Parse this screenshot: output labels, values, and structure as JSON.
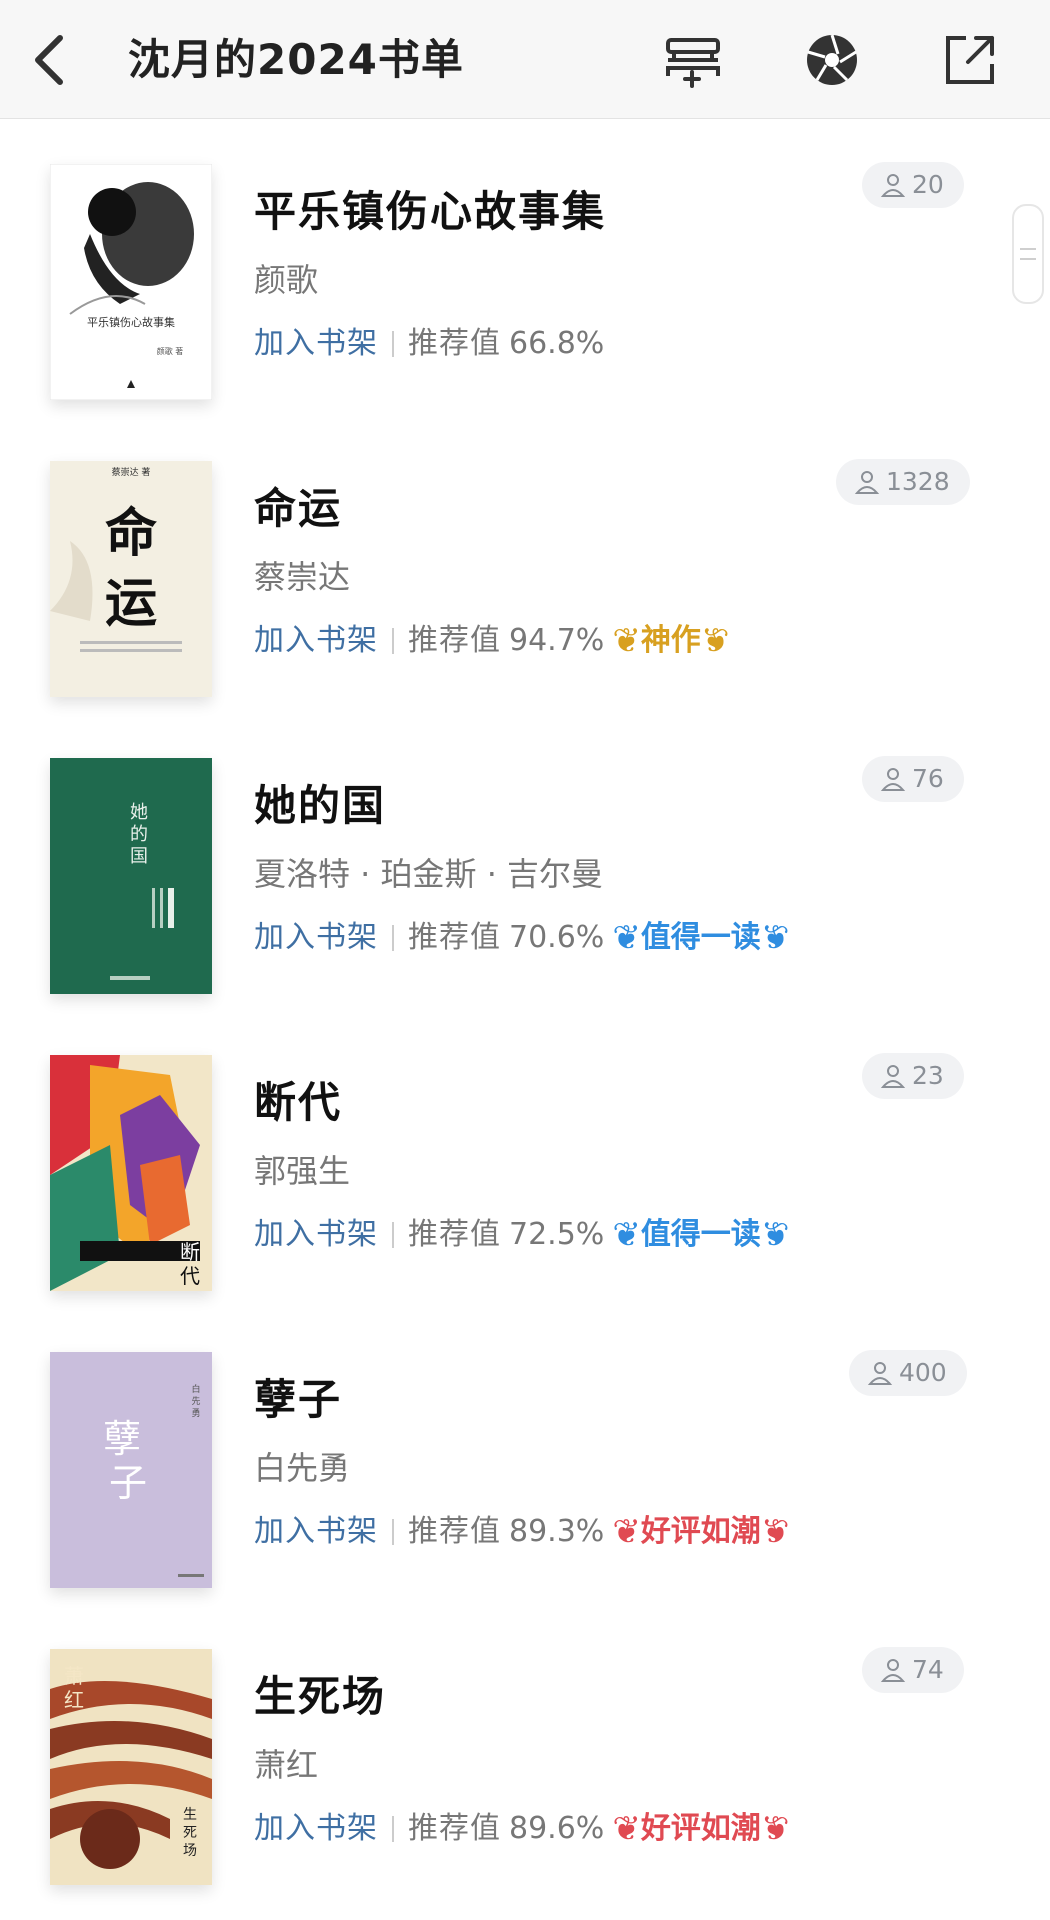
{
  "header": {
    "title": "沈月的2024书单",
    "icons": [
      "back-icon",
      "bookshelf-add-icon",
      "shutter-icon",
      "share-icon"
    ]
  },
  "rec_label": "推荐值",
  "add_label": "加入书架",
  "books": [
    {
      "title": "平乐镇伤心故事集",
      "author": "颜歌",
      "rec": "66.8%",
      "readers": "20",
      "badge": "",
      "badge_color": "",
      "cover": {
        "bg": "#ffffff",
        "text": "平乐镇伤心故事集",
        "sub": "颜歌 著"
      }
    },
    {
      "title": "命运",
      "author": "蔡崇达",
      "rec": "94.7%",
      "readers": "1328",
      "badge": "神作",
      "badge_color": "#d8a020",
      "cover": {
        "bg": "#f3efe2",
        "text": "命运",
        "top": "蔡崇达 著"
      }
    },
    {
      "title": "她的国",
      "author": "夏洛特 · 珀金斯 · 吉尔曼",
      "rec": "70.6%",
      "readers": "76",
      "badge": "值得一读",
      "badge_color": "#2f8de0",
      "cover": {
        "bg": "#1f6a4e",
        "text": "她的国"
      }
    },
    {
      "title": "断代",
      "author": "郭强生",
      "rec": "72.5%",
      "readers": "23",
      "badge": "值得一读",
      "badge_color": "#2f8de0",
      "cover": {
        "bg": "#e88a2a",
        "text": "断代"
      }
    },
    {
      "title": "孽子",
      "author": "白先勇",
      "rec": "89.3%",
      "readers": "400",
      "badge": "好评如潮",
      "badge_color": "#e04a52",
      "cover": {
        "bg": "#c9bedc",
        "text": "孽子",
        "top": "白先勇 著"
      }
    },
    {
      "title": "生死场",
      "author": "萧红",
      "rec": "89.6%",
      "readers": "74",
      "badge": "好评如潮",
      "badge_color": "#e04a52",
      "cover": {
        "bg": "#f0e3c2",
        "text": "生死场",
        "top": "萧红"
      }
    }
  ]
}
